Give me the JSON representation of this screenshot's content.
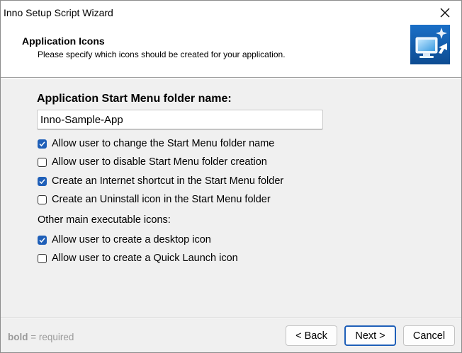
{
  "window": {
    "title": "Inno Setup Script Wizard",
    "close_icon": "close-icon"
  },
  "header": {
    "title": "Application Icons",
    "subtitle": "Please specify which icons should be created for your application.",
    "image_icon": "monitor-wizard-icon"
  },
  "form": {
    "folder_label": "Application Start Menu folder name:",
    "folder_value": "Inno-Sample-App",
    "options": [
      {
        "label": "Allow user to change the Start Menu folder name",
        "checked": true
      },
      {
        "label": "Allow user to disable Start Menu folder creation",
        "checked": false
      },
      {
        "label": "Create an Internet shortcut in the Start Menu folder",
        "checked": true
      },
      {
        "label": "Create an Uninstall icon in the Start Menu folder",
        "checked": false
      }
    ],
    "other_label": "Other main executable icons:",
    "other_options": [
      {
        "label": "Allow user to create a desktop icon",
        "checked": true
      },
      {
        "label": "Allow user to create a Quick Launch icon",
        "checked": false
      }
    ]
  },
  "footer": {
    "hint_bold": "bold",
    "hint_text": " = required",
    "back_label": "< Back",
    "next_label": "Next >",
    "cancel_label": "Cancel"
  },
  "colors": {
    "accent": "#1f5fb8",
    "dialog_bg": "#f0f0f0"
  }
}
